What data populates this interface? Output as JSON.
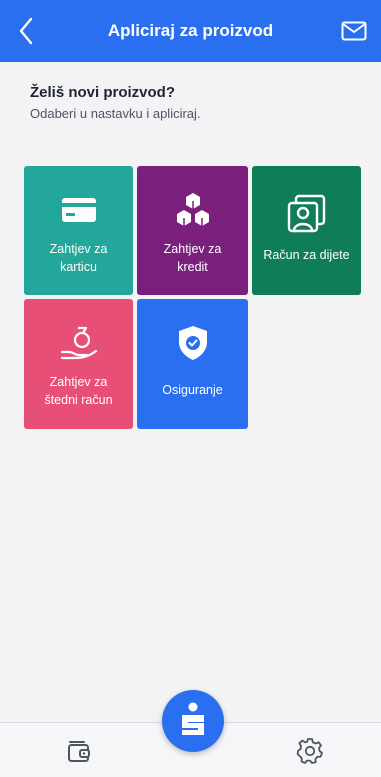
{
  "header": {
    "title": "Apliciraj za proizvod",
    "back_icon": "chevron-left-icon",
    "mail_icon": "envelope-icon",
    "background": "#2a6ff0"
  },
  "intro": {
    "heading": "Želiš novi proizvod?",
    "subtext": "Odaberi u nastavku i apliciraj."
  },
  "tiles": [
    {
      "label_line1": "Zahtjev za",
      "label_line2": "karticu",
      "icon": "credit-card-icon",
      "color": "#22a79a"
    },
    {
      "label_line1": "Zahtjev za",
      "label_line2": "kredit",
      "icon": "boxes-icon",
      "color": "#7a1f7c"
    },
    {
      "label_line1": "Račun za dijete",
      "label_line2": "",
      "icon": "child-portrait-icon",
      "color": "#0f7e56"
    },
    {
      "label_line1": "Zahtjev za",
      "label_line2": "štedni račun",
      "icon": "money-bag-hand-icon",
      "color": "#e84f77"
    },
    {
      "label_line1": "Osiguranje",
      "label_line2": "",
      "icon": "shield-check-icon",
      "color": "#2a6ff0"
    }
  ],
  "tabbar": {
    "left_icon": "wallet-icon",
    "center_icon": "sparkasse-logo-icon",
    "right_icon": "gear-icon"
  }
}
